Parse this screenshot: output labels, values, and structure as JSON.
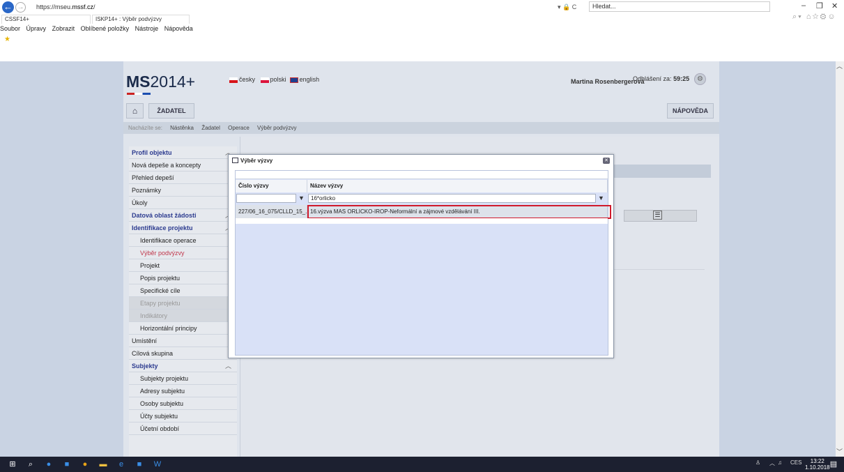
{
  "browser": {
    "url_prefix": "https://mseu.",
    "url_domain": "mssf.cz",
    "url_suffix": "/",
    "search_placeholder": "Hledat...",
    "addr_tools": "▾ 🔒 C",
    "tabs": [
      {
        "label": "CSSF14+"
      },
      {
        "label": "ISKP14+ : Výběr podvýzvy"
      }
    ],
    "menu": [
      "Soubor",
      "Úpravy",
      "Zobrazit",
      "Oblíbené položky",
      "Nástroje",
      "Nápověda"
    ],
    "window_controls": [
      "–",
      "❐",
      "✕"
    ],
    "right_tools": "⌕▾ ⌂☆⚙☺"
  },
  "app": {
    "logo_ms": "MS",
    "logo_year": "2014+",
    "languages": [
      "česky",
      "polski",
      "english"
    ],
    "user_name": "Martina Rosenbergerová",
    "session_label": "Odhlášení za:",
    "session_time": "59:25",
    "toolbar": {
      "applicant": "ŽADATEL",
      "help": "NÁPOVĚDA"
    },
    "breadcrumb": {
      "label": "Nacházíte se:",
      "items": [
        "Nástěnka",
        "Žadatel",
        "Operace",
        "Výběr podvýzvy"
      ]
    }
  },
  "sidebar": {
    "items": [
      {
        "label": "Profil objektu",
        "type": "sec",
        "chevron": "︿"
      },
      {
        "label": "Nová depeše a koncepty",
        "type": "item"
      },
      {
        "label": "Přehled depeší",
        "type": "item"
      },
      {
        "label": "Poznámky",
        "type": "item"
      },
      {
        "label": "Úkoly",
        "type": "item"
      },
      {
        "label": "Datová oblast žádosti",
        "type": "sec",
        "chevron": "︿"
      },
      {
        "label": "Identifikace projektu",
        "type": "sec",
        "chevron": "︿"
      },
      {
        "label": "Identifikace operace",
        "type": "sub"
      },
      {
        "label": "Výběr podvýzvy",
        "type": "sub active"
      },
      {
        "label": "Projekt",
        "type": "sub"
      },
      {
        "label": "Popis projektu",
        "type": "sub"
      },
      {
        "label": "Specifické cíle",
        "type": "sub"
      },
      {
        "label": "Etapy projektu",
        "type": "sub dim"
      },
      {
        "label": "Indikátory",
        "type": "sub dim"
      },
      {
        "label": "Horizontální principy",
        "type": "sub"
      },
      {
        "label": "Umístění",
        "type": "item"
      },
      {
        "label": "Cílová skupina",
        "type": "item"
      },
      {
        "label": "Subjekty",
        "type": "sec",
        "chevron": "︿"
      },
      {
        "label": "Subjekty projektu",
        "type": "sub"
      },
      {
        "label": "Adresy subjektu",
        "type": "sub"
      },
      {
        "label": "Osoby subjektu",
        "type": "sub"
      },
      {
        "label": "Účty subjektu",
        "type": "sub"
      },
      {
        "label": "Účetní období",
        "type": "sub"
      }
    ]
  },
  "modal": {
    "title": "Výběr výzvy",
    "columns": [
      "Číslo výzvy",
      "Název výzvy"
    ],
    "filters": {
      "number": "",
      "name": "16*orlicko"
    },
    "rows": [
      {
        "number": "227/06_16_075/CLLD_15_...",
        "name": "16.výzva MAS ORLICKO-IROP-Neformální a zájmové vzdělávání III."
      }
    ]
  },
  "taskbar": {
    "tray_text": "CES",
    "time": "13:22",
    "date": "1.10.2018"
  }
}
